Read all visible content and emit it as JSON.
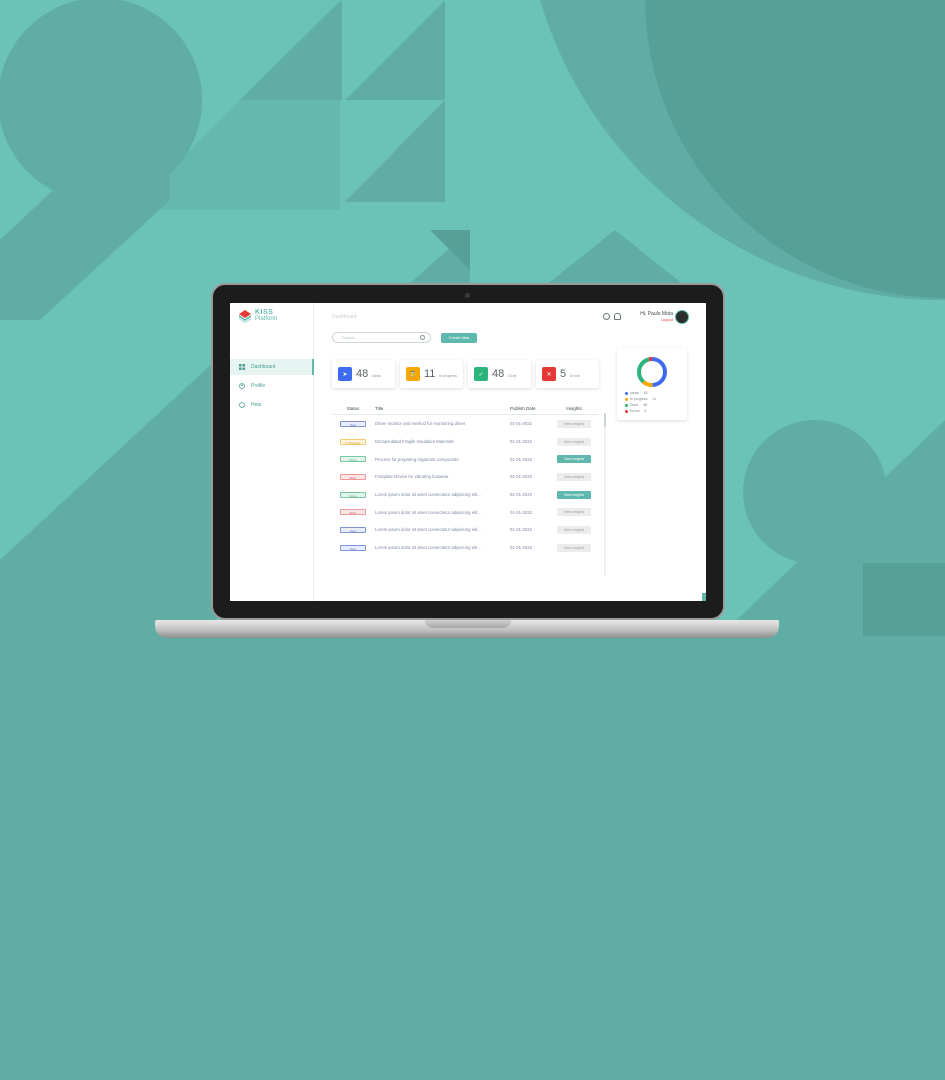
{
  "app": {
    "logo_line1": "KISS",
    "logo_line2": "Platform",
    "page_title": "Dashboard"
  },
  "sidebar": {
    "items": [
      {
        "label": "Dashboard",
        "icon": "grid-icon",
        "active": true
      },
      {
        "label": "Profile",
        "icon": "user-icon",
        "active": false
      },
      {
        "label": "Help",
        "icon": "help-icon",
        "active": false
      }
    ]
  },
  "search": {
    "placeholder": "Search"
  },
  "toolbar": {
    "create_label": "Create idea"
  },
  "user": {
    "greeting": "Hi, Paulo Mota",
    "logout_label": "Logout"
  },
  "stats": [
    {
      "value": "48",
      "label": "Ideas",
      "icon": "send-icon",
      "color": "#3d6cf0"
    },
    {
      "value": "11",
      "label": "In progress",
      "icon": "hourglass-icon",
      "color": "#f7a800"
    },
    {
      "value": "48",
      "label": "Done",
      "icon": "check-icon",
      "color": "#2cb57a"
    },
    {
      "value": "5",
      "label": "Errors",
      "icon": "close-icon",
      "color": "#e53935"
    }
  ],
  "donut": {
    "legend": [
      {
        "label": "Ideas",
        "value": "48",
        "color": "#3d6cf0"
      },
      {
        "label": "In progress",
        "value": "11",
        "color": "#f7a800"
      },
      {
        "label": "Done",
        "value": "48",
        "color": "#2cb57a"
      },
      {
        "label": "Errors",
        "value": "5",
        "color": "#e53935"
      }
    ]
  },
  "table": {
    "headers": [
      "Status",
      "Title",
      "Publish Date",
      "Insights"
    ],
    "rows": [
      {
        "status": "Sent",
        "status_kind": "sent",
        "title": "Driver monitor and method for monitoring driver",
        "date": "01-01-2022",
        "action": "View insights",
        "highlight": false
      },
      {
        "status": "In Progress",
        "status_kind": "progress",
        "title": "Encapsulated Fragile Insulation Materials",
        "date": "01-01-2022",
        "action": "View insights",
        "highlight": false
      },
      {
        "status": "Done",
        "status_kind": "done",
        "title": "Process for preparing organotin compounds",
        "date": "01-01-2022",
        "action": "View insights",
        "highlight": true
      },
      {
        "status": "Error",
        "status_kind": "error",
        "title": "Footplate Device for vibrating footwear",
        "date": "01-01-2022",
        "action": "View insights",
        "highlight": false
      },
      {
        "status": "Done",
        "status_kind": "done",
        "title": "Lorem ipsum dolor sit amet consectetur adipiscing elit...",
        "date": "01-01-2022",
        "action": "View insights",
        "highlight": true
      },
      {
        "status": "Error",
        "status_kind": "error",
        "title": "Lorem ipsum dolor sit amet consectetur adipiscing elit...",
        "date": "01-01-2022",
        "action": "View insights",
        "highlight": false
      },
      {
        "status": "Sent",
        "status_kind": "sent",
        "title": "Lorem ipsum dolor sit amet consectetur adipiscing elit...",
        "date": "01-01-2022",
        "action": "View insights",
        "highlight": false
      },
      {
        "status": "Sent",
        "status_kind": "sent",
        "title": "Lorem ipsum dolor sit amet consectetur adipiscing elit...",
        "date": "01-01-2022",
        "action": "View insights",
        "highlight": false
      }
    ]
  },
  "colors": {
    "accent": "#5fb8ad",
    "bg_top": "#6bc3b8",
    "bg_bottom": "#5fada4",
    "shape_dark": "#57a097"
  }
}
